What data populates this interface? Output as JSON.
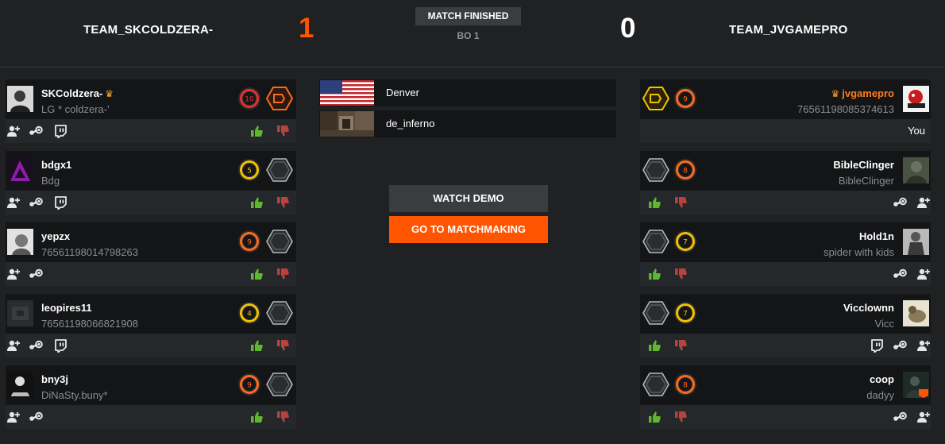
{
  "match": {
    "team1": {
      "name": "TEAM_SKCOLDZERA-",
      "score": "1"
    },
    "team2": {
      "name": "TEAM_JVGAMEPRO",
      "score": "0"
    },
    "status": "MATCH FINISHED",
    "format": "BO 1"
  },
  "server": {
    "location": "Denver",
    "map": "de_inferno"
  },
  "buttons": {
    "watch_demo": "WATCH DEMO",
    "go_matchmaking": "GO TO MATCHMAKING"
  },
  "team1_players": [
    {
      "name": "SKColdzera-",
      "sub": "LG * coldzera-'",
      "level": "10",
      "level_color": "#e53030",
      "captain": true,
      "twitch": true
    },
    {
      "name": "bdgx1",
      "sub": "Bdg",
      "level": "5",
      "level_color": "#f2c200",
      "captain": false,
      "twitch": true
    },
    {
      "name": "yepzx",
      "sub": "76561198014798263",
      "level": "9",
      "level_color": "#ff6a1a",
      "captain": false,
      "twitch": false
    },
    {
      "name": "leopires11",
      "sub": "76561198066821908",
      "level": "4",
      "level_color": "#f2c200",
      "captain": false,
      "twitch": true
    },
    {
      "name": "bny3j",
      "sub": "DiNaSty.buny*",
      "level": "9",
      "level_color": "#ff6a1a",
      "captain": false,
      "twitch": false
    }
  ],
  "team2_players": [
    {
      "name": "jvgamepro",
      "sub": "76561198085374613",
      "level": "9",
      "level_color": "#ff6a1a",
      "captain": true,
      "you": "You"
    },
    {
      "name": "BibleClinger",
      "sub": "BibleClinger",
      "level": "8",
      "level_color": "#ff6a1a",
      "captain": false,
      "twitch": false
    },
    {
      "name": "Hold1n",
      "sub": "spider with kids",
      "level": "7",
      "level_color": "#f2c200",
      "captain": false,
      "twitch": false
    },
    {
      "name": "Vicclownn",
      "sub": "Vicc",
      "level": "7",
      "level_color": "#f2c200",
      "captain": false,
      "twitch": true
    },
    {
      "name": "coop",
      "sub": "dadyy",
      "level": "8",
      "level_color": "#ff6a1a",
      "captain": false,
      "twitch": false
    }
  ],
  "colors": {
    "accent": "#ff5500",
    "thumbs_up": "#5fb730",
    "thumbs_down": "#b8433e",
    "captain": "#ffa21a"
  },
  "icons": [
    "add-friend-icon",
    "steam-icon",
    "twitch-icon",
    "thumbs-up-icon",
    "thumbs-down-icon",
    "crown-icon",
    "skill-level-icon",
    "rank-badge-icon",
    "us-flag-icon",
    "map-thumbnail"
  ]
}
